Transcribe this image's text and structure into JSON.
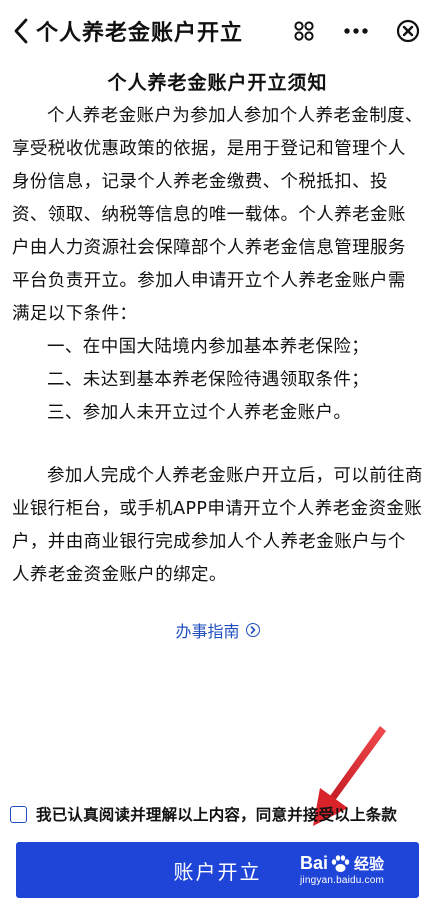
{
  "header": {
    "title": "个人养老金账户开立",
    "icons": [
      "back-icon",
      "mini-program-icon",
      "more-icon",
      "close-icon"
    ]
  },
  "notice": {
    "title": "个人养老金账户开立须知",
    "paragraph1": "个人养老金账户为参加人参加个人养老金制度、享受税收优惠政策的依据，是用于登记和管理个人身份信息，记录个人养老金缴费、个税抵扣、投资、领取、纳税等信息的唯一载体。个人养老金账户由人力资源社会保障部个人养老金信息管理服务平台负责开立。参加人申请开立个人养老金账户需满足以下条件：",
    "conditions": [
      "一、在中国大陆境内参加基本养老保险；",
      "二、未达到基本养老保险待遇领取条件；",
      "三、参加人未开立过个人养老金账户。"
    ],
    "paragraph2": "参加人完成个人养老金账户开立后，可以前往商业银行柜台，或手机APP申请开立个人养老金资金账户，并由商业银行完成参加人个人养老金账户与个人养老金资金账户的绑定。"
  },
  "guide": {
    "label": "办事指南"
  },
  "agreement": {
    "text": "我已认真阅读并理解以上内容，同意并接受以上条款",
    "checked": false
  },
  "submit": {
    "label": "账户开立"
  },
  "watermark": {
    "brand_left": "Bai",
    "brand_right": "经验",
    "url": "jingyan.baidu.com"
  },
  "colors": {
    "accent": "#1f45d8",
    "link": "#1f4fbf",
    "arrow": "#e0252b"
  }
}
